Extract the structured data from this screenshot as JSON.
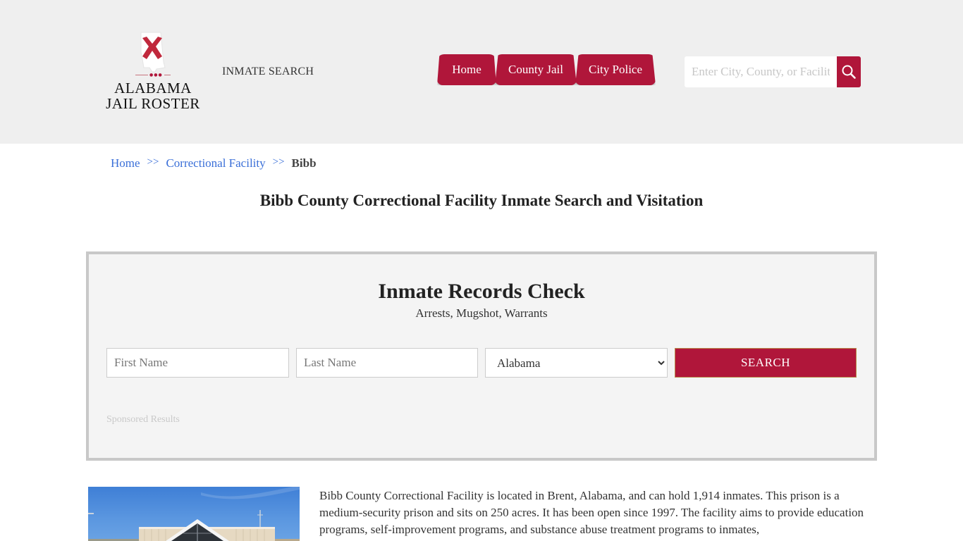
{
  "header": {
    "logo": {
      "line1": "ALABAMA",
      "line2": "JAIL ROSTER",
      "icon": "alabama-state-flag-icon"
    },
    "site_label": "INMATE SEARCH",
    "nav": [
      {
        "label": "Home"
      },
      {
        "label": "County Jail"
      },
      {
        "label": "City Police"
      }
    ],
    "search": {
      "placeholder": "Enter City, County, or Facility",
      "value": "",
      "icon": "search-icon"
    }
  },
  "breadcrumb": {
    "items": [
      {
        "label": "Home"
      },
      {
        "label": "Correctional Facility"
      }
    ],
    "separator": ">>",
    "current": "Bibb"
  },
  "page_title": "Bibb County Correctional Facility Inmate Search and Visitation",
  "records_check": {
    "title": "Inmate Records Check",
    "subtitle": "Arrests, Mugshot, Warrants",
    "first_name": {
      "placeholder": "First Name",
      "value": ""
    },
    "last_name": {
      "placeholder": "Last Name",
      "value": ""
    },
    "state": {
      "selected": "Alabama"
    },
    "submit_label": "SEARCH",
    "sponsored_label": "Sponsored Results"
  },
  "facility": {
    "photo_alt": "Bibb County Correctional Facility building",
    "description": "Bibb County Correctional Facility is located in Brent, Alabama, and can hold 1,914 inmates. This prison is a medium-security prison and sits on 250 acres. It has been open since 1997. The facility aims to provide education programs, self-improvement programs, and substance abuse treatment programs to inmates,"
  },
  "colors": {
    "brand": "#b0163a",
    "link": "#3a6fd8",
    "header_bg": "#efefef",
    "panel_bg": "#f4f4f4"
  }
}
